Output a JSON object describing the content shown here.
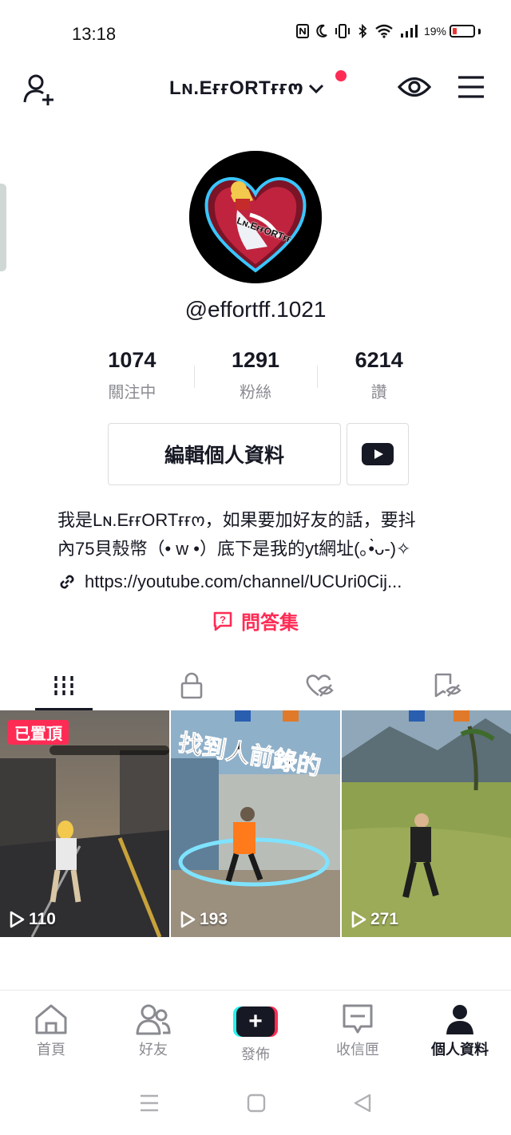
{
  "status_bar": {
    "time": "13:18",
    "battery_percent": "19%",
    "battery_level": 0.19,
    "icons": [
      "nfc-icon",
      "moon-icon",
      "vibrate-icon",
      "bluetooth-icon",
      "wifi-icon",
      "signal-icon",
      "battery-icon"
    ]
  },
  "header": {
    "account_name": "Lɴ.EғғORTғғო",
    "has_notification_dot": true
  },
  "profile": {
    "avatar_text": "Lɴ.EғғORTғғ",
    "handle": "@effortff.1021",
    "stats": [
      {
        "value": "1074",
        "label": "關注中"
      },
      {
        "value": "1291",
        "label": "粉絲"
      },
      {
        "value": "6214",
        "label": "讚"
      }
    ],
    "edit_button_label": "編輯個人資料",
    "bio_lines": [
      "我是Lɴ.EғғORTғғო，如果要加好友的話，要抖",
      "內75貝殼幣（• ᴡ •）底下是我的yt網址(｡•̀ᴗ-)✧"
    ],
    "link": "https://youtube.com/channel/UCUri0Cij...",
    "qa_label": "問答集"
  },
  "tabs": [
    "videos-tab",
    "private-tab",
    "liked-tab",
    "saved-tab"
  ],
  "videos": [
    {
      "pinned_label": "已置頂",
      "plays": "110"
    },
    {
      "plays": "193",
      "overlay_text": "找到人前錄的"
    },
    {
      "plays": "271"
    }
  ],
  "bottom_nav": [
    {
      "label": "首頁"
    },
    {
      "label": "好友"
    },
    {
      "label": "發佈"
    },
    {
      "label": "收信匣"
    },
    {
      "label": "個人資料"
    }
  ],
  "colors": {
    "accent": "#fe2c55",
    "cyan": "#25f4ee",
    "text": "#161823",
    "secondary": "#8a8b91"
  }
}
